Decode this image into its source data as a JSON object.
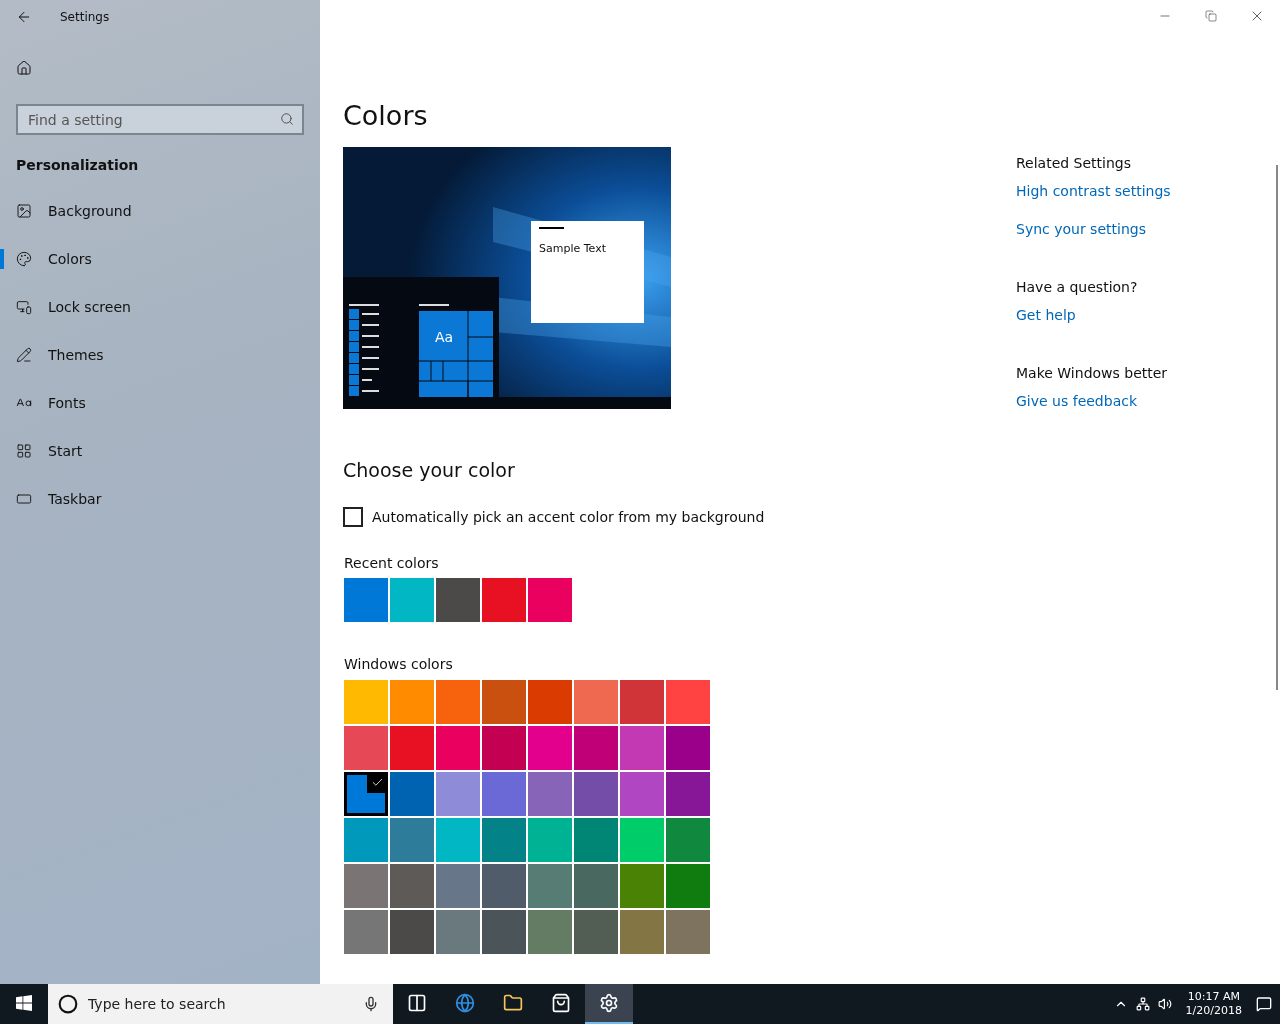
{
  "window": {
    "title": "Settings"
  },
  "sidebar": {
    "search": {
      "placeholder": "Find a setting"
    },
    "heading": "Personalization",
    "items": [
      {
        "label": "Background",
        "kind": "background",
        "selected": false
      },
      {
        "label": "Colors",
        "kind": "colors",
        "selected": true
      },
      {
        "label": "Lock screen",
        "kind": "lock",
        "selected": false
      },
      {
        "label": "Themes",
        "kind": "themes",
        "selected": false
      },
      {
        "label": "Fonts",
        "kind": "fonts",
        "selected": false
      },
      {
        "label": "Start",
        "kind": "start",
        "selected": false
      },
      {
        "label": "Taskbar",
        "kind": "taskbar",
        "selected": false
      }
    ]
  },
  "page": {
    "title": "Colors",
    "preview": {
      "sample_text": "Sample Text",
      "tile_label": "Aa"
    },
    "section_title": "Choose your color",
    "auto_accent": {
      "label": "Automatically pick an accent color from my background",
      "checked": false
    },
    "recent": {
      "label": "Recent colors",
      "swatches": [
        {
          "color": "#0078d7"
        },
        {
          "color": "#00b7c3"
        },
        {
          "color": "#4c4a48"
        },
        {
          "color": "#e81123"
        },
        {
          "color": "#ea005e"
        }
      ]
    },
    "windows_colors": {
      "label": "Windows colors",
      "swatches": [
        {
          "color": "#ffb900",
          "selected": false
        },
        {
          "color": "#ff8c00",
          "selected": false
        },
        {
          "color": "#f7630c",
          "selected": false
        },
        {
          "color": "#ca5010",
          "selected": false
        },
        {
          "color": "#da3b01",
          "selected": false
        },
        {
          "color": "#ef6950",
          "selected": false
        },
        {
          "color": "#d13438",
          "selected": false
        },
        {
          "color": "#ff4343",
          "selected": false
        },
        {
          "color": "#e74856",
          "selected": false
        },
        {
          "color": "#e81123",
          "selected": false
        },
        {
          "color": "#ea005e",
          "selected": false
        },
        {
          "color": "#c30052",
          "selected": false
        },
        {
          "color": "#e3008c",
          "selected": false
        },
        {
          "color": "#bf0077",
          "selected": false
        },
        {
          "color": "#c239b3",
          "selected": false
        },
        {
          "color": "#9a0089",
          "selected": false
        },
        {
          "color": "#0078d7",
          "selected": true
        },
        {
          "color": "#0063b1",
          "selected": false
        },
        {
          "color": "#8e8cd8",
          "selected": false
        },
        {
          "color": "#6b69d6",
          "selected": false
        },
        {
          "color": "#8764b8",
          "selected": false
        },
        {
          "color": "#744da9",
          "selected": false
        },
        {
          "color": "#b146c2",
          "selected": false
        },
        {
          "color": "#881798",
          "selected": false
        },
        {
          "color": "#0099bc",
          "selected": false
        },
        {
          "color": "#2d7d9a",
          "selected": false
        },
        {
          "color": "#00b7c3",
          "selected": false
        },
        {
          "color": "#038387",
          "selected": false
        },
        {
          "color": "#00b294",
          "selected": false
        },
        {
          "color": "#018574",
          "selected": false
        },
        {
          "color": "#00cc6a",
          "selected": false
        },
        {
          "color": "#10893e",
          "selected": false
        },
        {
          "color": "#7a7574",
          "selected": false
        },
        {
          "color": "#5d5a58",
          "selected": false
        },
        {
          "color": "#68768a",
          "selected": false
        },
        {
          "color": "#515c6b",
          "selected": false
        },
        {
          "color": "#567c73",
          "selected": false
        },
        {
          "color": "#486860",
          "selected": false
        },
        {
          "color": "#498205",
          "selected": false
        },
        {
          "color": "#107c10",
          "selected": false
        },
        {
          "color": "#767676",
          "selected": false
        },
        {
          "color": "#4c4a48",
          "selected": false
        },
        {
          "color": "#69797e",
          "selected": false
        },
        {
          "color": "#4a5459",
          "selected": false
        },
        {
          "color": "#647c64",
          "selected": false
        },
        {
          "color": "#525e54",
          "selected": false
        },
        {
          "color": "#847545",
          "selected": false
        },
        {
          "color": "#7e735f",
          "selected": false
        }
      ]
    }
  },
  "related": [
    {
      "heading": "Related Settings",
      "links": [
        "High contrast settings",
        "Sync your settings"
      ]
    },
    {
      "heading": "Have a question?",
      "links": [
        "Get help"
      ]
    },
    {
      "heading": "Make Windows better",
      "links": [
        "Give us feedback"
      ]
    }
  ],
  "taskbar": {
    "search_placeholder": "Type here to search",
    "apps": [
      {
        "kind": "task-view",
        "selected": false
      },
      {
        "kind": "browser",
        "selected": false
      },
      {
        "kind": "folder",
        "selected": false
      },
      {
        "kind": "store",
        "selected": false
      },
      {
        "kind": "settings",
        "selected": true
      }
    ],
    "clock": {
      "time": "10:17 AM",
      "date": "1/20/2018"
    }
  }
}
